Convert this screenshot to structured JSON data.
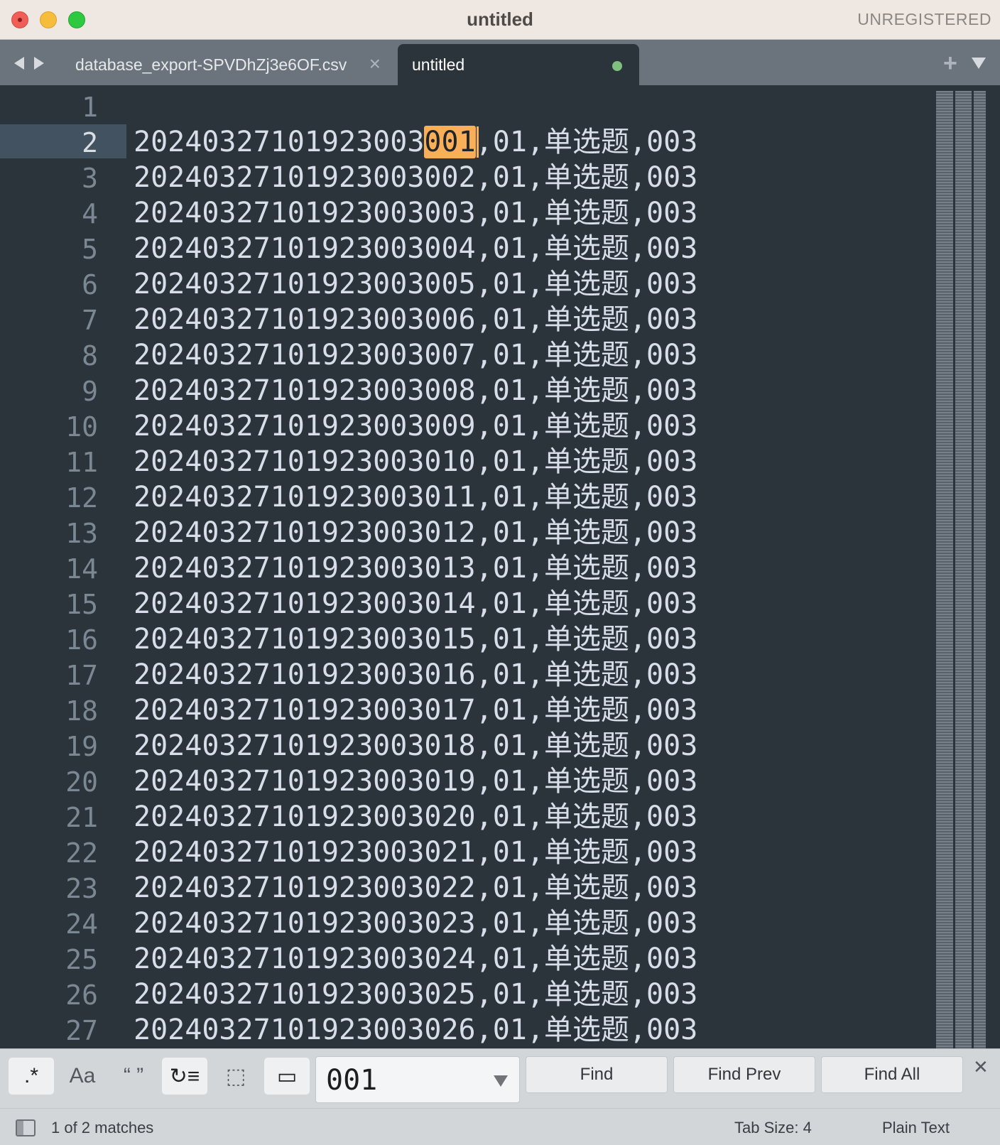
{
  "window": {
    "title": "untitled",
    "registration": "UNREGISTERED"
  },
  "tabs": [
    {
      "label": "database_export-SPVDhZj3e6OF.csv",
      "active": false
    },
    {
      "label": "untitled",
      "active": true,
      "dirty": true
    }
  ],
  "editor": {
    "current_line": 2,
    "match_text": "001",
    "lines": [
      {
        "num": "1",
        "pre": "",
        "match": "",
        "post": ""
      },
      {
        "num": "2",
        "pre": "20240327101923003",
        "match": "001",
        "post": ",01,单选题,003"
      },
      {
        "num": "3",
        "pre": "20240327101923003002,01,单选题,003",
        "match": "",
        "post": ""
      },
      {
        "num": "4",
        "pre": "20240327101923003003,01,单选题,003",
        "match": "",
        "post": ""
      },
      {
        "num": "5",
        "pre": "20240327101923003004,01,单选题,003",
        "match": "",
        "post": ""
      },
      {
        "num": "6",
        "pre": "20240327101923003005,01,单选题,003",
        "match": "",
        "post": ""
      },
      {
        "num": "7",
        "pre": "20240327101923003006,01,单选题,003",
        "match": "",
        "post": ""
      },
      {
        "num": "8",
        "pre": "20240327101923003007,01,单选题,003",
        "match": "",
        "post": ""
      },
      {
        "num": "9",
        "pre": "20240327101923003008,01,单选题,003",
        "match": "",
        "post": ""
      },
      {
        "num": "10",
        "pre": "20240327101923003009,01,单选题,003",
        "match": "",
        "post": ""
      },
      {
        "num": "11",
        "pre": "20240327101923003010,01,单选题,003",
        "match": "",
        "post": ""
      },
      {
        "num": "12",
        "pre": "20240327101923003011,01,单选题,003",
        "match": "",
        "post": ""
      },
      {
        "num": "13",
        "pre": "20240327101923003012,01,单选题,003",
        "match": "",
        "post": ""
      },
      {
        "num": "14",
        "pre": "20240327101923003013,01,单选题,003",
        "match": "",
        "post": ""
      },
      {
        "num": "15",
        "pre": "20240327101923003014,01,单选题,003",
        "match": "",
        "post": ""
      },
      {
        "num": "16",
        "pre": "20240327101923003015,01,单选题,003",
        "match": "",
        "post": ""
      },
      {
        "num": "17",
        "pre": "20240327101923003016,01,单选题,003",
        "match": "",
        "post": ""
      },
      {
        "num": "18",
        "pre": "20240327101923003017,01,单选题,003",
        "match": "",
        "post": ""
      },
      {
        "num": "19",
        "pre": "20240327101923003018,01,单选题,003",
        "match": "",
        "post": ""
      },
      {
        "num": "20",
        "pre": "20240327101923003019,01,单选题,003",
        "match": "",
        "post": ""
      },
      {
        "num": "21",
        "pre": "20240327101923003020,01,单选题,003",
        "match": "",
        "post": ""
      },
      {
        "num": "22",
        "pre": "20240327101923003021,01,单选题,003",
        "match": "",
        "post": ""
      },
      {
        "num": "23",
        "pre": "20240327101923003022,01,单选题,003",
        "match": "",
        "post": ""
      },
      {
        "num": "24",
        "pre": "20240327101923003023,01,单选题,003",
        "match": "",
        "post": ""
      },
      {
        "num": "25",
        "pre": "20240327101923003024,01,单选题,003",
        "match": "",
        "post": ""
      },
      {
        "num": "26",
        "pre": "20240327101923003025,01,单选题,003",
        "match": "",
        "post": ""
      },
      {
        "num": "27",
        "pre": "20240327101923003026,01,单选题,003",
        "match": "",
        "post": ""
      }
    ]
  },
  "find_panel": {
    "options": [
      {
        "name": "regex-toggle",
        "glyph": ".*",
        "on": true
      },
      {
        "name": "case-sensitive-toggle",
        "glyph": "Aa",
        "on": false
      },
      {
        "name": "whole-word-toggle",
        "glyph": "“ ”",
        "on": false
      },
      {
        "name": "wrap-toggle",
        "glyph": "↻≡",
        "on": true
      },
      {
        "name": "in-selection-toggle",
        "glyph": "⬚",
        "on": false
      },
      {
        "name": "highlight-matches-toggle",
        "glyph": "▭",
        "on": true
      }
    ],
    "query": "001",
    "find_label": "Find",
    "find_prev_label": "Find Prev",
    "find_all_label": "Find All"
  },
  "status": {
    "matches": "1 of 2 matches",
    "tab_size": "Tab Size: 4",
    "syntax": "Plain Text"
  },
  "colors": {
    "editor_bg": "#2b333b",
    "match_highlight": "#f9ae58",
    "dirty_dot": "#7fc07f"
  }
}
